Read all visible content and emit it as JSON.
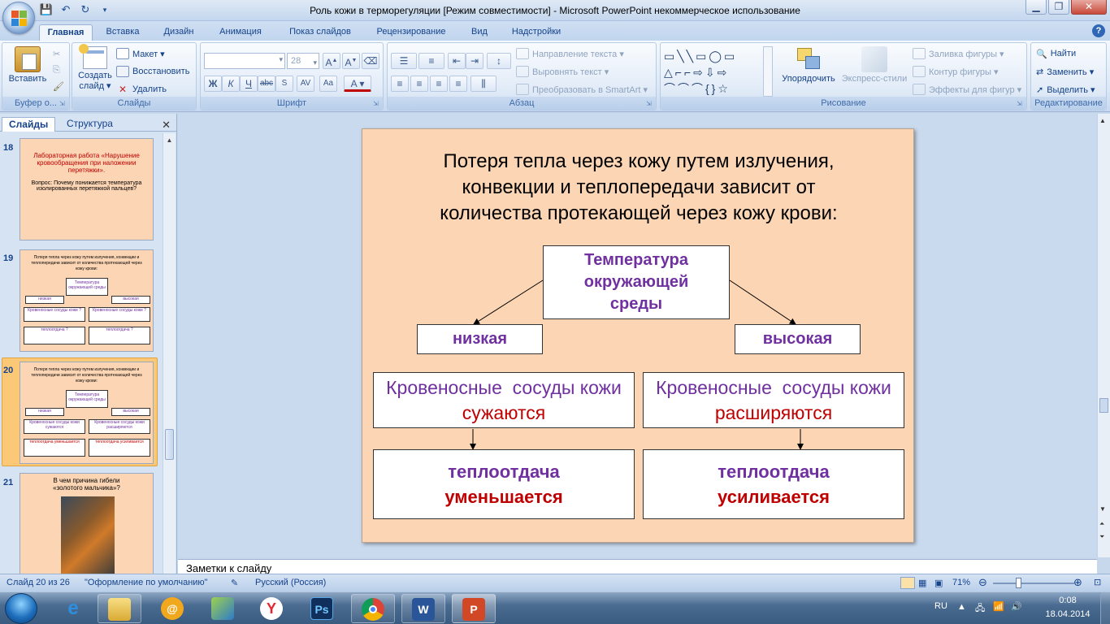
{
  "window": {
    "title": "Роль кожи в терморегуляции [Режим совместимости] - Microsoft PowerPoint некоммерческое использование"
  },
  "tabs": [
    "Главная",
    "Вставка",
    "Дизайн",
    "Анимация",
    "Показ слайдов",
    "Рецензирование",
    "Вид",
    "Надстройки"
  ],
  "ribbon": {
    "clipboard": {
      "label": "Буфер о...",
      "paste": "Вставить"
    },
    "slides": {
      "label": "Слайды",
      "new_slide": "Создать",
      "new_slide2": "слайд ▾",
      "layout": "Макет ▾",
      "reset": "Восстановить",
      "delete": "Удалить"
    },
    "font": {
      "label": "Шрифт",
      "size": "28"
    },
    "paragraph": {
      "label": "Абзац",
      "text_direction": "Направление текста ▾",
      "align_text": "Выровнять текст ▾",
      "smartart": "Преобразовать в SmartArt ▾"
    },
    "drawing": {
      "label": "Рисование",
      "arrange": "Упорядочить",
      "quick_styles": "Экспресс-стили",
      "fill": "Заливка фигуры ▾",
      "outline": "Контур фигуры ▾",
      "effects": "Эффекты для фигур ▾"
    },
    "editing": {
      "label": "Редактирование",
      "find": "Найти",
      "replace": "Заменить ▾",
      "select": "Выделить ▾"
    }
  },
  "pane": {
    "tab_slides": "Слайды",
    "tab_outline": "Структура",
    "thumbs": [
      {
        "num": "18",
        "line1": "Лабораторная работа «Нарушение кровообращения при наложении перетяжки».",
        "line2": "Вопрос: Почему понижается температура изолированных перетяжкой пальцев?"
      },
      {
        "num": "19",
        "title": "Потеря тепла через кожу путем излучения, конвекции и теплопередачи зависит от количества протекающей через кожу крови:",
        "top": "Температура окружающей среды",
        "low": "низкая",
        "high": "высокая",
        "v1": "Кровеносные сосуды кожи ?",
        "v2": "Кровеносные сосуды кожи ?",
        "t1": "теплоотдача ?",
        "t2": "теплоотдача ?"
      },
      {
        "num": "20",
        "title": "Потеря тепла через кожу путем излучения, конвекции и теплопередачи зависит от количества протекающей через кожу крови:",
        "top": "Температура окружающей среды",
        "low": "низкая",
        "high": "высокая",
        "v1": "Кровеносные сосуды кожи сужаются",
        "v2": "Кровеносные сосуды кожи расширяются",
        "t1": "теплоотдача уменьшается",
        "t2": "теплоотдача усиливается"
      },
      {
        "num": "21",
        "title": "В чем причина гибели «золотого мальчика»?"
      }
    ]
  },
  "slide": {
    "title_l1": "Потеря тепла через кожу путем излучения,",
    "title_l2": "конвекции и теплопередачи зависит от",
    "title_l3": "количества протекающей через кожу крови:",
    "top_box": [
      "Температура",
      "окружающей",
      "среды"
    ],
    "low": "низкая",
    "high": "высокая",
    "vessels_left_l1": "Кровеносные  сосуды кожи",
    "vessels_left_l2": "сужаются",
    "vessels_right_l1": "Кровеносные  сосуды кожи",
    "vessels_right_l2": "расширяются",
    "heat_left_l1": "теплоотдача",
    "heat_left_l2": "уменьшается",
    "heat_right_l1": "теплоотдача",
    "heat_right_l2": "усиливается"
  },
  "notes": {
    "placeholder": "Заметки к слайду"
  },
  "status": {
    "slide_counter": "Слайд 20 из 26",
    "theme": "\"Оформление по умолчанию\"",
    "language": "Русский (Россия)",
    "zoom": "71%"
  },
  "taskbar": {
    "lang": "RU",
    "time": "0:08",
    "date": "18.04.2014"
  },
  "colors": {
    "slide_bg": "#fcd5b4",
    "purple": "#7030a0",
    "red": "#c00000"
  }
}
